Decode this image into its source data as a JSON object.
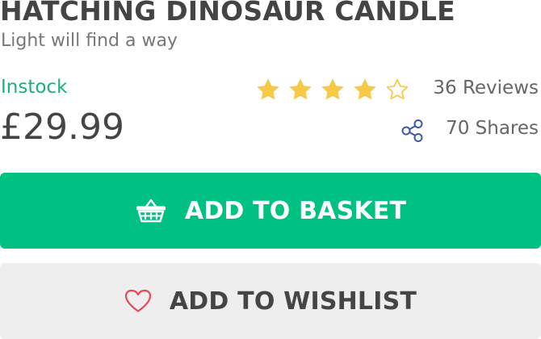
{
  "product": {
    "title": "HATCHING DINOSAUR CANDLE",
    "subtitle": "Light will find a way",
    "stock_status": "Instock",
    "price": "£29.99"
  },
  "rating": {
    "value": 4,
    "max": 5,
    "reviews_label": "36 Reviews"
  },
  "social": {
    "shares_label": "70 Shares"
  },
  "actions": {
    "basket_label": "ADD TO BASKET",
    "wishlist_label": "ADD TO WISHLIST"
  },
  "colors": {
    "accent_green": "#00c082",
    "stock_green": "#19b07a",
    "star_gold": "#f7c948",
    "share_blue": "#3c5aa6",
    "heart_red": "#e8495a",
    "wishlist_bg": "#eeeeee"
  },
  "icons": {
    "star": "star-icon",
    "share": "share-icon",
    "basket": "basket-icon",
    "wishlist": "heart-icon"
  }
}
